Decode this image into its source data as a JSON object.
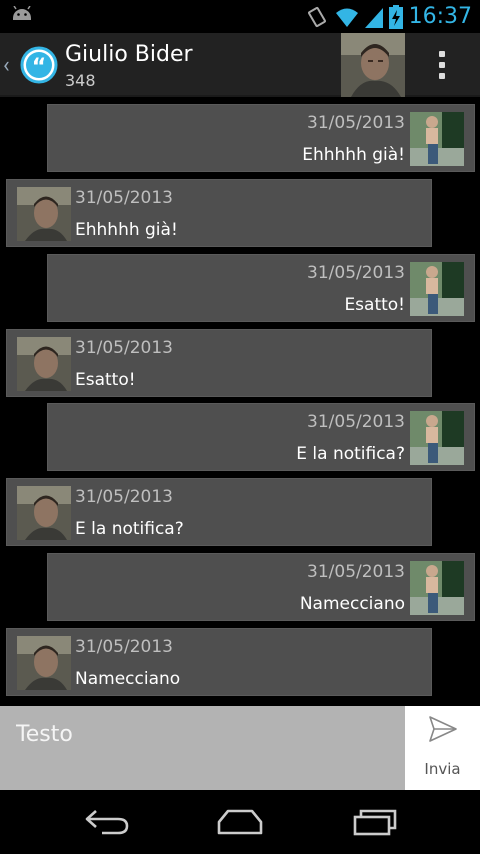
{
  "status_bar": {
    "time": "16:37",
    "icons": [
      "android-icon",
      "vibrate-icon",
      "wifi-icon",
      "signal-icon",
      "battery-charging-icon"
    ],
    "accent_color": "#33b5e5"
  },
  "action_bar": {
    "title": "Giulio Bider",
    "subtitle": "348",
    "icons": [
      "back-chevron-icon",
      "app-quote-logo-icon",
      "contact-avatar",
      "overflow-menu-icon"
    ]
  },
  "messages": [
    {
      "direction": "out",
      "date": "31/05/2013",
      "text": "Ehhhhh già!"
    },
    {
      "direction": "in",
      "date": "31/05/2013",
      "text": "Ehhhhh già!"
    },
    {
      "direction": "out",
      "date": "31/05/2013",
      "text": "Esatto!"
    },
    {
      "direction": "in",
      "date": "31/05/2013",
      "text": "Esatto!"
    },
    {
      "direction": "out",
      "date": "31/05/2013",
      "text": "E la notifica?"
    },
    {
      "direction": "in",
      "date": "31/05/2013",
      "text": "E la notifica?"
    },
    {
      "direction": "out",
      "date": "31/05/2013",
      "text": "Namecciano"
    },
    {
      "direction": "in",
      "date": "31/05/2013",
      "text": "Namecciano"
    }
  ],
  "composer": {
    "placeholder": "Testo",
    "value": "",
    "send_label": "Invia"
  },
  "nav_bar": {
    "icons": [
      "back-icon",
      "home-icon",
      "recents-icon"
    ]
  }
}
